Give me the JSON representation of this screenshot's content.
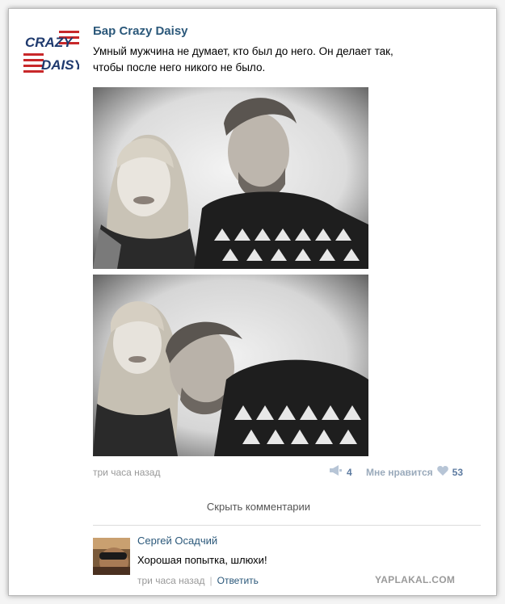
{
  "post": {
    "author": "Бар Crazy Daisy",
    "logo_text": [
      "CRAZY",
      "DAISY"
    ],
    "text_line1": "Умный мужчина не думает, кто был до него. Он делает так,",
    "text_line2": "чтобы после него никого не было.",
    "time": "три часа назад",
    "share_count": "4",
    "like_label": "Мне нравится",
    "like_count": "53"
  },
  "comments": {
    "toggle_label": "Скрыть комментарии",
    "items": [
      {
        "author": "Сергей Осадчий",
        "text": "Хорошая попытка, шлюхи!",
        "time": "три часа назад",
        "separator": "|",
        "reply_label": "Ответить"
      }
    ]
  },
  "watermark": "YAPLAKAL.COM",
  "colors": {
    "link_blue": "#2b587a",
    "logo_navy": "#1f3a6e",
    "logo_red": "#c8282a",
    "like_heart": "#b7c5d6"
  }
}
